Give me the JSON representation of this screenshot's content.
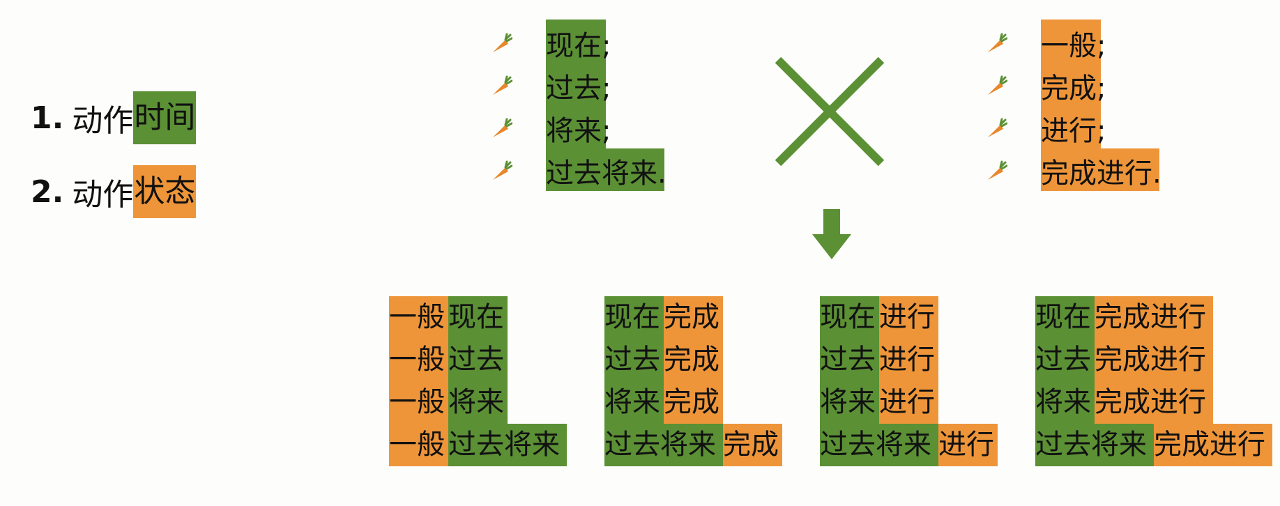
{
  "legend": [
    {
      "num": "1.",
      "prefix": "动作",
      "highlight": "时间",
      "color": "#5b9035"
    },
    {
      "num": "2.",
      "prefix": "动作",
      "highlight": "状态",
      "color": "#ee953a"
    }
  ],
  "time_list": [
    "现在",
    "过去",
    "将来",
    "过去将来"
  ],
  "state_list": [
    "一般",
    "完成",
    "进行",
    "完成进行"
  ],
  "punct": {
    "semi": ";",
    "period": "."
  },
  "operators": {
    "times": "cross-icon",
    "arrow": "arrow-down-icon"
  },
  "colors": {
    "time": "#5b9035",
    "state": "#ee953a"
  },
  "grids": [
    {
      "state": "一般",
      "state_first": true
    },
    {
      "state": "完成",
      "state_first": false
    },
    {
      "state": "进行",
      "state_first": false
    },
    {
      "state": "完成进行",
      "state_first": false
    }
  ]
}
